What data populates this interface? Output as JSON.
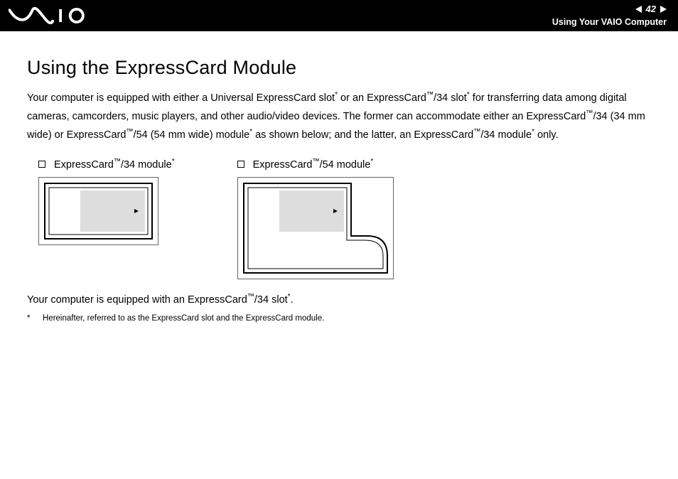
{
  "header": {
    "page_number": "42",
    "section": "Using Your VAIO Computer"
  },
  "title": "Using the ExpressCard Module",
  "paragraph": {
    "p1a": "Your computer is equipped with either a Universal ExpressCard slot",
    "p1b": " or an ExpressCard",
    "p1c": "/34 slot",
    "p1d": " for transferring data among digital cameras, camcorders, music players, and other audio/video devices. The former can accommodate either an ExpressCard",
    "p1e": "/34 (34 mm wide) or ExpressCard",
    "p1f": "/54 (54 mm wide) module",
    "p1g": " as shown below; and the latter, an ExpressCard",
    "p1h": "/34 module",
    "p1i": " only."
  },
  "modules": {
    "m34": {
      "prefix": "ExpressCard",
      "suffix": "/34 module"
    },
    "m54": {
      "prefix": "ExpressCard",
      "suffix": "/54 module"
    }
  },
  "equip": {
    "a": "Your computer is equipped with an ExpressCard",
    "b": "/34 slot",
    "c": "."
  },
  "footnote": {
    "mark": "*",
    "text": "Hereinafter, referred to as the ExpressCard slot and the ExpressCard module."
  },
  "sym": {
    "tm": "™",
    "star": "*"
  }
}
